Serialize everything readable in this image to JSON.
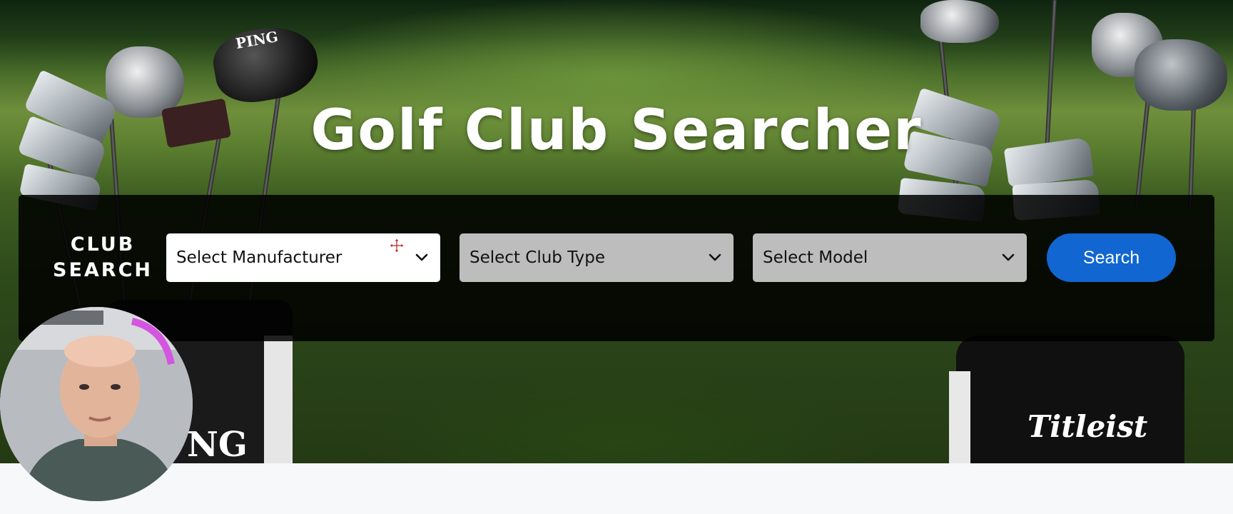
{
  "hero": {
    "title": "Golf Club Searcher",
    "bag_brands": {
      "left": "PING",
      "left_bag": "NG",
      "right": "Titleist"
    }
  },
  "search": {
    "label": "CLUB SEARCH",
    "manufacturer_select": {
      "value": "Select Manufacturer",
      "state": "enabled"
    },
    "club_type_select": {
      "value": "Select Club Type",
      "state": "disabled"
    },
    "model_select": {
      "value": "Select Model",
      "state": "disabled"
    },
    "search_button": "Search"
  },
  "icons": {
    "chevron": "chevron-down-icon",
    "cursor": "move-cursor-icon"
  },
  "colors": {
    "panel": "#000000",
    "button": "#1166d1",
    "disabled_select": "#bdbdbd"
  }
}
